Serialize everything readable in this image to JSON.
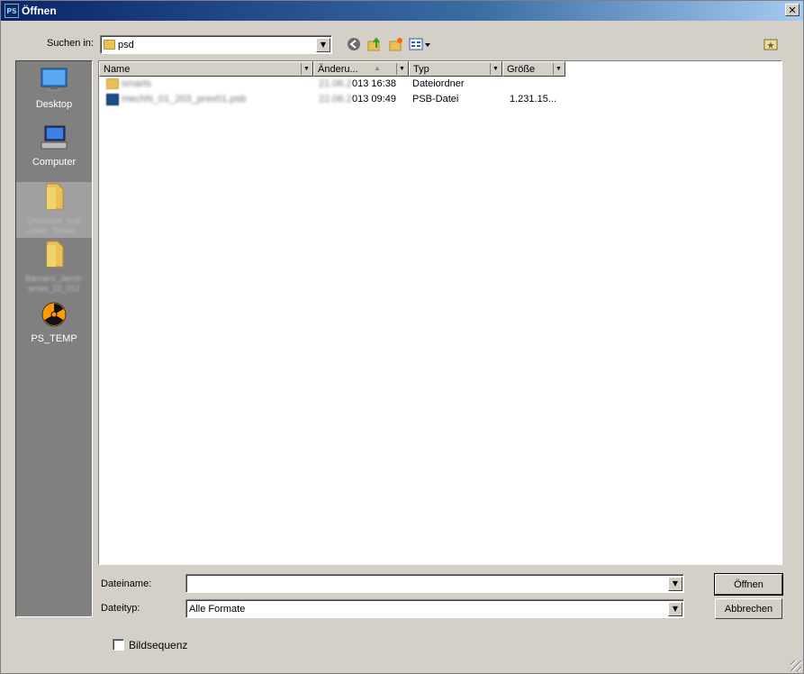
{
  "window": {
    "title": "Öffnen",
    "app_icon": "PS",
    "close_glyph": "✕"
  },
  "toolbar": {
    "look_in_label": "Suchen in:",
    "look_in_value": "psd",
    "icons": [
      "back-icon",
      "up-folder-icon",
      "new-folder-icon",
      "view-menu-icon",
      "favorite-folder-icon"
    ]
  },
  "places": [
    {
      "label": "Desktop",
      "icon": "desktop-icon"
    },
    {
      "label": "Computer",
      "icon": "computer-icon"
    },
    {
      "label": "Chevrolet_Sub urban_Tahoe...",
      "icon": "folder-icon",
      "obscured": true
    },
    {
      "label": "Banners_Jarott- amas_12_012",
      "icon": "folder-icon",
      "obscured": true
    },
    {
      "label": "PS_TEMP",
      "icon": "radioactive-icon"
    }
  ],
  "columns": [
    {
      "label": "Name"
    },
    {
      "label": "Änderu..."
    },
    {
      "label": "Typ"
    },
    {
      "label": "Größe"
    }
  ],
  "files": [
    {
      "name": "smarts",
      "date_prefix": "21.06.2",
      "date": "013 16:38",
      "type": "Dateiordner",
      "size": "",
      "icon": "folder-icon"
    },
    {
      "name": "mechN_01_203_prev01.psb",
      "date_prefix": "22.06.2",
      "date": "013 09:49",
      "type": "PSB-Datei",
      "size": "1.231.15...",
      "icon": "psb-file-icon"
    }
  ],
  "form": {
    "filename_label": "Dateiname:",
    "filename_value": "",
    "filetype_label": "Dateityp:",
    "filetype_value": "Alle Formate",
    "open_button": "Öffnen",
    "cancel_button": "Abbrechen",
    "sequence_label": "Bildsequenz",
    "sequence_checked": false
  }
}
